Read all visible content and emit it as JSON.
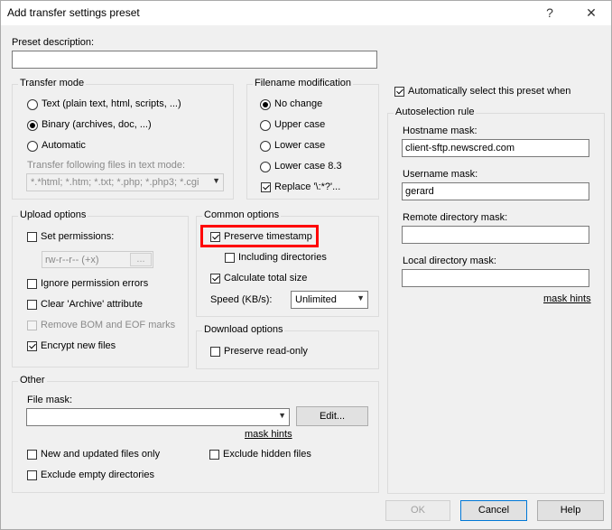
{
  "window": {
    "title": "Add transfer settings preset",
    "help_btn": "?",
    "close_btn": "✕"
  },
  "preset": {
    "label": "Preset description:",
    "value": ""
  },
  "transfer_mode": {
    "title": "Transfer mode",
    "text": "Text (plain text, html, scripts, ...)",
    "binary": "Binary (archives, doc, ...)",
    "automatic": "Automatic",
    "following_label": "Transfer following files in text mode:",
    "mask_value": "*.*html; *.htm; *.txt; *.php; *.php3; *.cgi"
  },
  "filename_mod": {
    "title": "Filename modification",
    "no_change": "No change",
    "upper": "Upper case",
    "lower": "Lower case",
    "lower83": "Lower case 8.3",
    "replace": "Replace '\\:*?'..."
  },
  "auto_select": {
    "label": "Automatically select this preset when"
  },
  "autoselection": {
    "title": "Autoselection rule",
    "hostname_label": "Hostname mask:",
    "hostname_value": "client-sftp.newscred.com",
    "username_label": "Username mask:",
    "username_value": "gerard",
    "remote_label": "Remote directory mask:",
    "remote_value": "",
    "local_label": "Local directory mask:",
    "local_value": "",
    "mask_hints": "mask hints"
  },
  "upload": {
    "title": "Upload options",
    "set_permissions": "Set permissions:",
    "permissions_value": "rw-r--r-- (+x)",
    "perm_button": "...",
    "ignore_perm": "Ignore permission errors",
    "clear_archive": "Clear 'Archive' attribute",
    "remove_bom": "Remove BOM and EOF marks",
    "encrypt": "Encrypt new files"
  },
  "common": {
    "title": "Common options",
    "preserve_ts": "Preserve timestamp",
    "including_dirs": "Including directories",
    "calc_size": "Calculate total size",
    "speed_label": "Speed (KB/s):",
    "speed_value": "Unlimited"
  },
  "download": {
    "title": "Download options",
    "preserve_ro": "Preserve read-only"
  },
  "other": {
    "title": "Other",
    "file_mask_label": "File mask:",
    "file_mask_value": "",
    "edit_button": "Edit...",
    "mask_hints": "mask hints",
    "new_updated": "New and updated files only",
    "exclude_hidden": "Exclude hidden files",
    "exclude_empty": "Exclude empty directories"
  },
  "buttons": {
    "ok": "OK",
    "cancel": "Cancel",
    "help": "Help"
  },
  "colors": {
    "highlight": "#ff0000",
    "default_border": "#0078d7"
  }
}
